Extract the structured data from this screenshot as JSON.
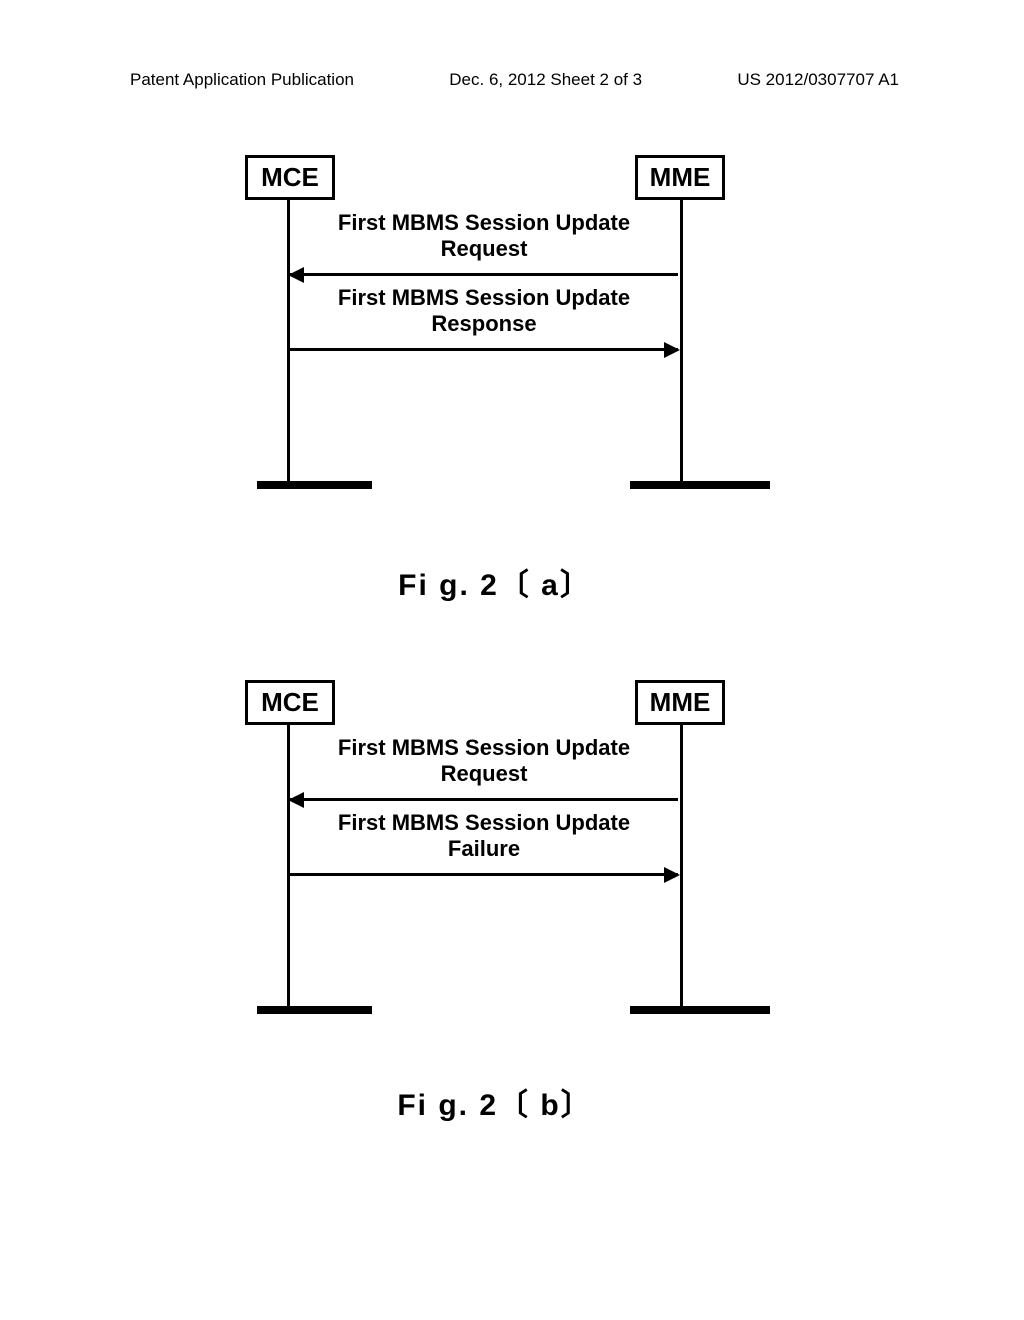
{
  "header": {
    "left": "Patent Application Publication",
    "center": "Dec. 6, 2012 Sheet 2 of 3",
    "right": "US 2012/0307707 A1"
  },
  "diagram_a": {
    "entity_left": "MCE",
    "entity_right": "MME",
    "message1_line1": "First MBMS Session Update",
    "message1_line2": "Request",
    "message2_line1": "First MBMS Session Update",
    "message2_line2": "Response"
  },
  "diagram_b": {
    "entity_left": "MCE",
    "entity_right": "MME",
    "message1_line1": "First MBMS Session Update",
    "message1_line2": "Request",
    "message2_line1": "First MBMS Session Update",
    "message2_line2": "Failure"
  },
  "captions": {
    "fig_a": "Fi g. 2〔 a〕",
    "fig_b": "Fi g. 2〔 b〕"
  }
}
